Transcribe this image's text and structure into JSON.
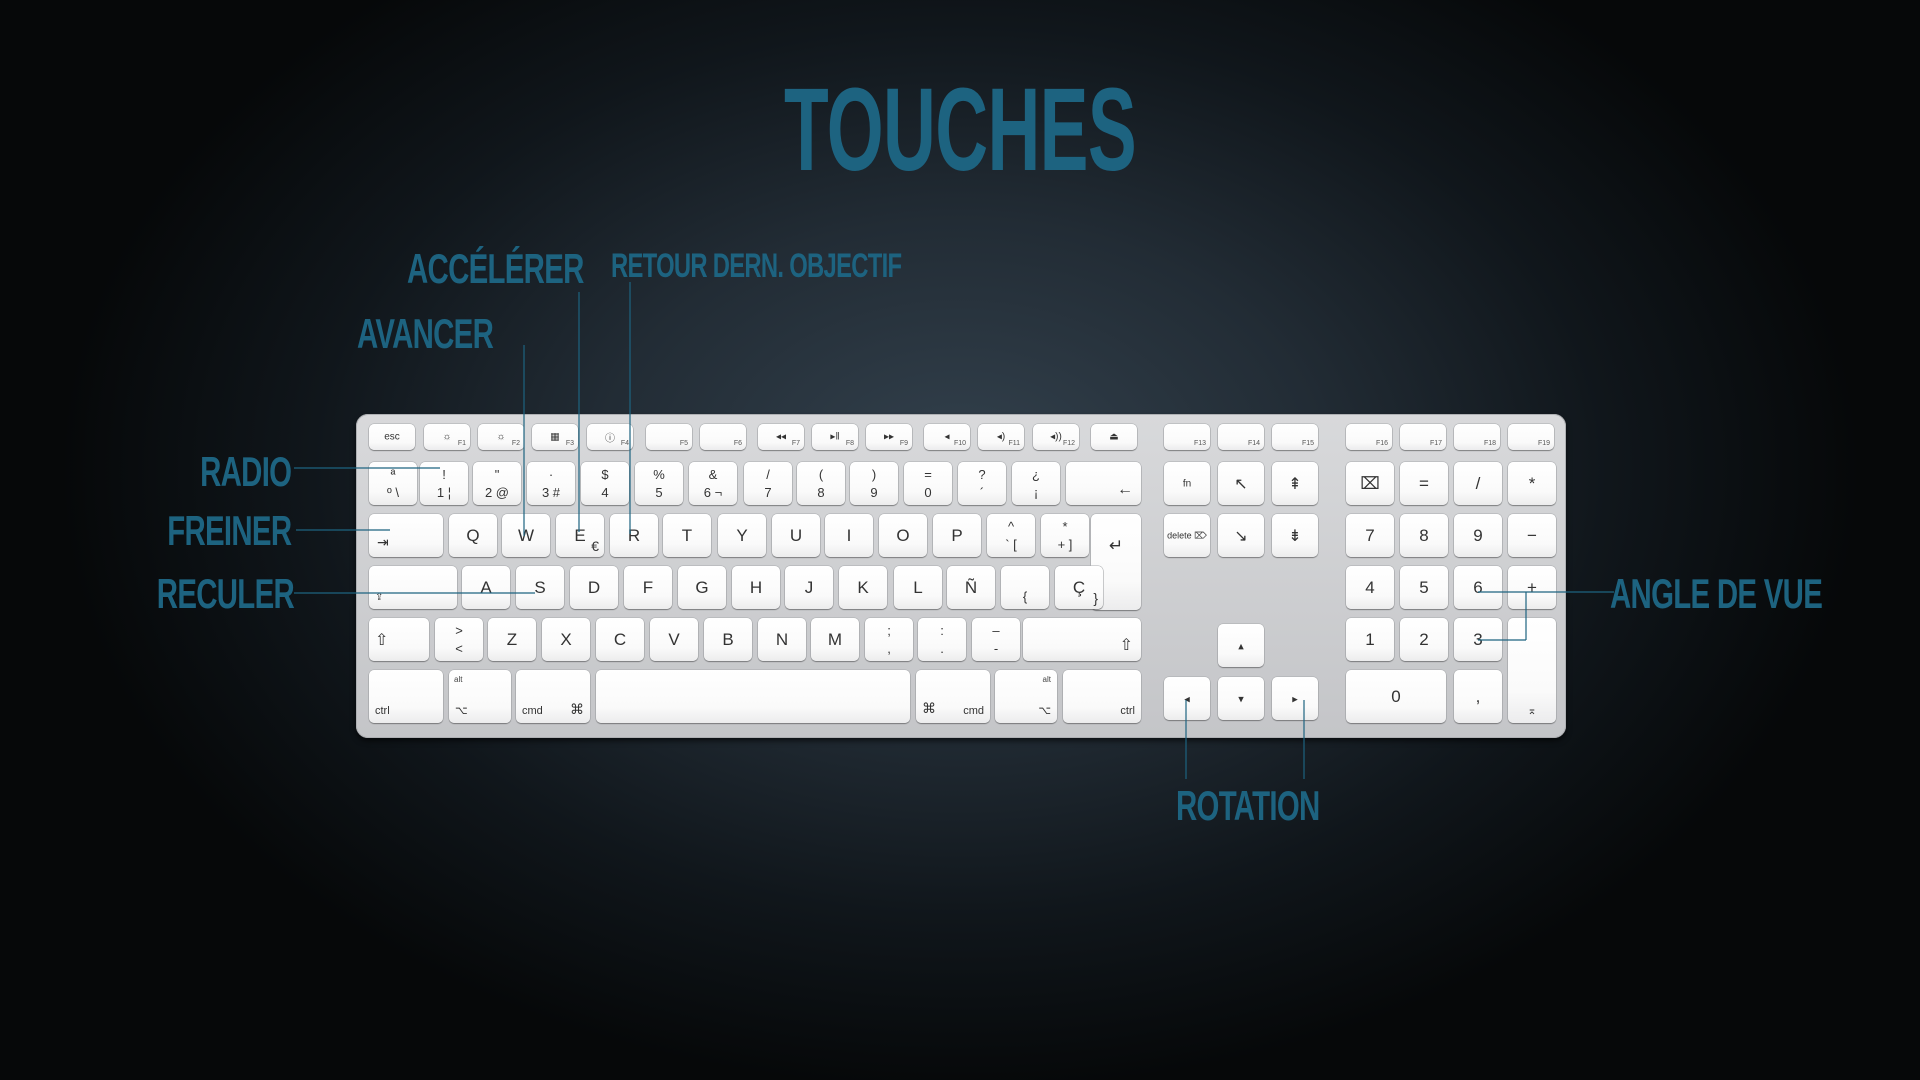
{
  "title": "TOUCHES",
  "labels": {
    "accelerer": "ACCÉLÉRER",
    "retour": "RETOUR DERN. OBJECTIF",
    "avancer": "AVANCER",
    "radio": "RADIO",
    "freiner": "FREINER",
    "reculer": "RECULER",
    "angle": "ANGLE DE VUE",
    "rotation": "ROTATION"
  },
  "colors": {
    "label": "#1d6380",
    "line": "#1d6380",
    "keyboard_body": "#c8c9cc",
    "key_face": "#ffffff"
  },
  "keyboard": {
    "fn_row": [
      {
        "main": "esc"
      },
      {
        "main": "☼",
        "corner": "F1"
      },
      {
        "main": "☼",
        "corner": "F2"
      },
      {
        "main": "▦",
        "corner": "F3"
      },
      {
        "main": "ⓘ",
        "corner": "F4"
      },
      {
        "main": "",
        "corner": "F5"
      },
      {
        "main": "",
        "corner": "F6"
      },
      {
        "main": "◂◂",
        "corner": "F7"
      },
      {
        "main": "▸ǁ",
        "corner": "F8"
      },
      {
        "main": "▸▸",
        "corner": "F9"
      },
      {
        "main": "◂",
        "corner": "F10"
      },
      {
        "main": "◂)",
        "corner": "F11"
      },
      {
        "main": "◂))",
        "corner": "F12"
      },
      {
        "main": "⏏"
      },
      {
        "main": "",
        "corner": "F13"
      },
      {
        "main": "",
        "corner": "F14"
      },
      {
        "main": "",
        "corner": "F15"
      },
      {
        "main": "",
        "corner": "F16"
      },
      {
        "main": "",
        "corner": "F17"
      },
      {
        "main": "",
        "corner": "F18"
      },
      {
        "main": "",
        "corner": "F19"
      }
    ],
    "num_row": [
      {
        "top": "ª",
        "bot": "º \\"
      },
      {
        "top": "!",
        "bot": "1 ¦"
      },
      {
        "top": "\"",
        "bot": "2 @"
      },
      {
        "top": "·",
        "bot": "3 #"
      },
      {
        "top": "$",
        "bot": "4"
      },
      {
        "top": "%",
        "bot": "5"
      },
      {
        "top": "&",
        "bot": "6 ¬"
      },
      {
        "top": "/",
        "bot": "7"
      },
      {
        "top": "(",
        "bot": "8"
      },
      {
        "top": ")",
        "bot": "9"
      },
      {
        "top": "=",
        "bot": "0"
      },
      {
        "top": "?",
        "bot": "´"
      },
      {
        "top": "¿",
        "bot": "¡"
      },
      {
        "main": "←"
      }
    ],
    "q_row": [
      "Q",
      "W",
      "E",
      "R",
      "T",
      "Y",
      "U",
      "I",
      "O",
      "P"
    ],
    "q_row_extra": [
      {
        "top": "^",
        "bot": "` ["
      },
      {
        "top": "*",
        "bot": "+ ]"
      }
    ],
    "e_sub": "€",
    "tab_symbol": "⇥",
    "return_symbol": "↵",
    "a_row": [
      "A",
      "S",
      "D",
      "F",
      "G",
      "H",
      "J",
      "K",
      "L",
      "Ñ"
    ],
    "a_row_extra": [
      {
        "bot": "{"
      },
      {
        "main": "Ç",
        "sub": "}"
      }
    ],
    "caps_symbol": "⇪",
    "z_row": [
      {
        "top": ">",
        "bot": "<"
      },
      {
        "main": "Z"
      },
      {
        "main": "X"
      },
      {
        "main": "C"
      },
      {
        "main": "V"
      },
      {
        "main": "B"
      },
      {
        "main": "N"
      },
      {
        "main": "M"
      },
      {
        "top": ";",
        "bot": ","
      },
      {
        "top": ":",
        "bot": "."
      },
      {
        "top": "–",
        "bot": "-"
      }
    ],
    "shift_symbol": "⇧",
    "bottom_row": {
      "ctrl": "ctrl",
      "alt": "alt",
      "option_symbol": "⌥",
      "cmd": "cmd",
      "cmd_symbol": "⌘"
    },
    "nav": {
      "fn": "fn",
      "home": "↖",
      "page_up": "⇞",
      "delete": "delete ⌦",
      "end": "↘",
      "page_down": "⇟",
      "up": "▴",
      "left": "◂",
      "down": "▾",
      "right": "▸"
    },
    "numpad": {
      "row1": [
        "⌧",
        "=",
        "/",
        "*"
      ],
      "row2": [
        "7",
        "8",
        "9",
        "−"
      ],
      "row3": [
        "4",
        "5",
        "6",
        "+"
      ],
      "row4": [
        "1",
        "2",
        "3"
      ],
      "zero": "0",
      "decimal": ",",
      "enter": "⌅"
    }
  }
}
